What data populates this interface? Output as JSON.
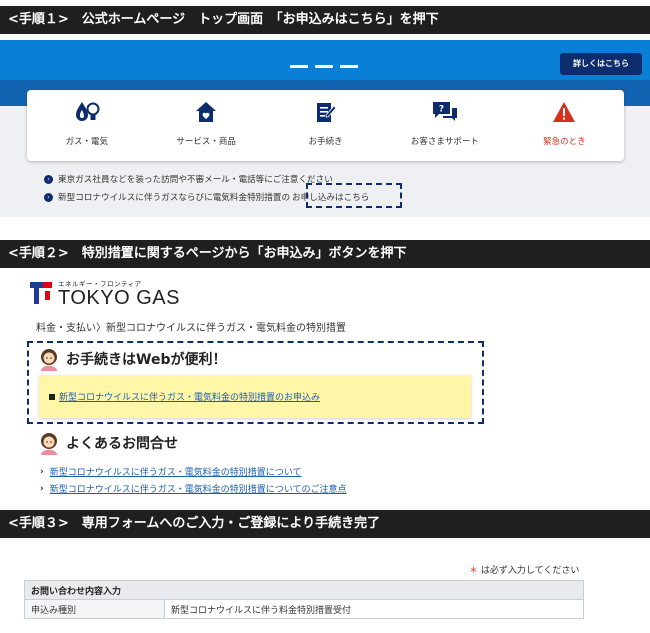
{
  "steps": [
    {
      "label": "<手順１>　公式ホームページ　トップ画面　「お申込みはこちら」を押下"
    },
    {
      "label": "<手順２>　特別措置に関するページから「お申込み」ボタンを押下"
    },
    {
      "label": "<手順３>　専用フォームへのご入力・ご登録により手続き完了"
    }
  ],
  "homepage": {
    "detail_button": "詳しくはこちら",
    "nav_items": [
      {
        "label": "ガス・電気",
        "icon": "flame-bulb-icon"
      },
      {
        "label": "サービス・商品",
        "icon": "house-heart-icon"
      },
      {
        "label": "お手続き",
        "icon": "document-pen-icon"
      },
      {
        "label": "お客さまサポート",
        "icon": "chat-question-icon"
      },
      {
        "label": "緊急のとき",
        "icon": "warning-icon"
      }
    ],
    "notices": [
      {
        "text": "東京ガス社員などを装った訪問や不審メール・電話等にご注意ください"
      },
      {
        "text": "新型コロナウイルスに伴うガスならびに電気料金特別措置の",
        "highlight": "お申し込みはこちら"
      }
    ],
    "colors": {
      "accent": "#0a7fd6",
      "navy": "#0d2c6e",
      "emergency": "#d9301e"
    }
  },
  "special_page": {
    "logo_ruby": "エネルギー・フロンティア",
    "logo_text": "TOKYO GAS",
    "breadcrumb": "料金・支払い〉新型コロナウイルスに伴うガス・電気料金の特別措置",
    "web_heading": "お手続きはWebが便利！",
    "apply_link": "新型コロナウイルスに伴うガス・電気料金の特別措置のお申込み",
    "faq_heading": "よくあるお問合せ",
    "faq_links": [
      "新型コロナウイルスに伴うガス・電気料金の特別措置について",
      "新型コロナウイルスに伴うガス・電気料金の特別措置についてのご注意点"
    ]
  },
  "form": {
    "required_note_star": "＊",
    "required_note": "は必ず入力してください",
    "section_title": "お問い合わせ内容入力",
    "rows": [
      {
        "key": "申込み種別",
        "value": "新型コロナウイルスに伴う料金特別措置受付"
      }
    ]
  }
}
